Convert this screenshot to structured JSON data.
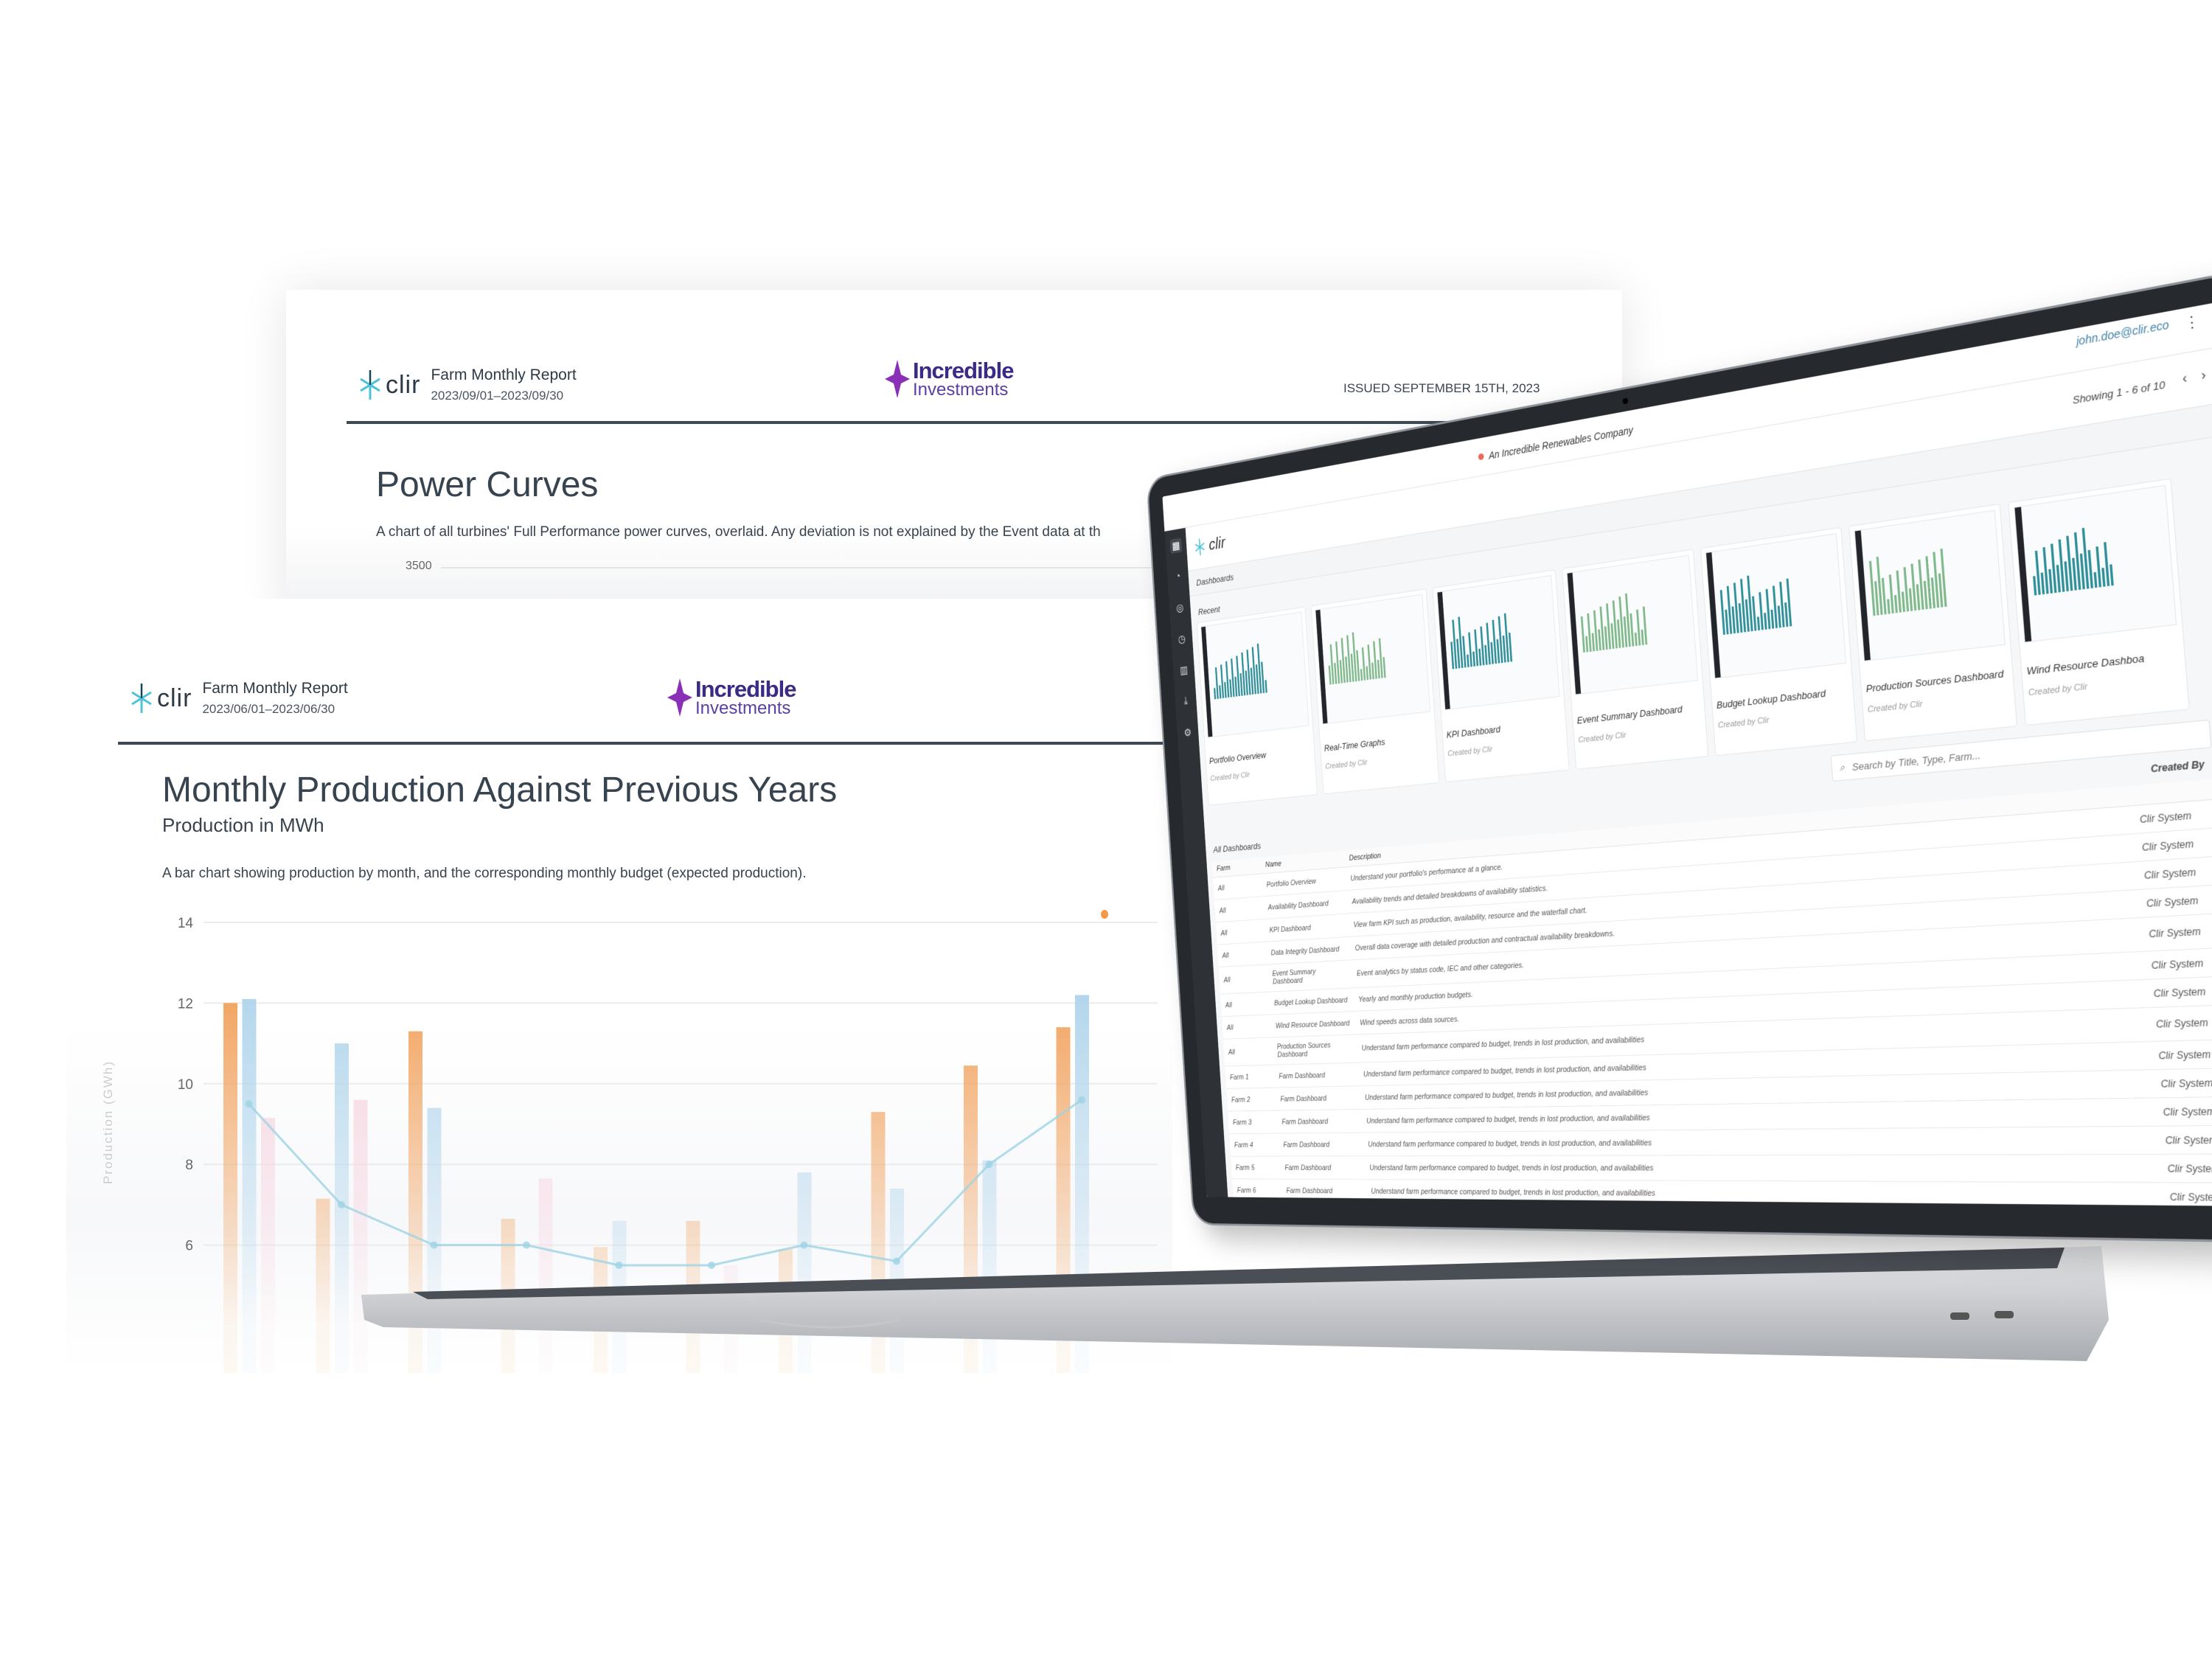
{
  "back_report": {
    "brand": "clir",
    "title": "Farm Monthly Report",
    "period": "2023/09/01–2023/09/30",
    "partner_line1": "Incredible",
    "partner_line2": "Investments",
    "issued": "ISSUED SEPTEMBER 15TH, 2023",
    "section_title": "Power Curves",
    "description": "A chart of all turbines' Full Performance power curves, overlaid. Any deviation is not explained by the Event data at th",
    "y_tick": "3500"
  },
  "front_report": {
    "brand": "clir",
    "title": "Farm Monthly Report",
    "period": "2023/06/01–2023/06/30",
    "partner_line1": "Incredible",
    "partner_line2": "Investments",
    "section_title": "Monthly Production Against Previous Years",
    "subtitle": "Production in MWh",
    "description": "A bar chart showing production by month, and the corresponding monthly budget (expected production)."
  },
  "chart_data": {
    "type": "bar",
    "ylabel": "Production (GWh)",
    "ylim": [
      0,
      14
    ],
    "yticks": [
      "6",
      "8",
      "10",
      "12",
      "14"
    ],
    "grid": true,
    "series": [
      {
        "color": "#f2a461",
        "values": [
          12.0,
          7.15,
          11.3,
          6.65,
          5.95,
          6.6,
          5.9,
          9.3,
          10.45,
          11.4
        ]
      },
      {
        "color": "#b3d6ec",
        "values": [
          12.1,
          11.0,
          9.4,
          null,
          6.6,
          null,
          7.8,
          7.4,
          8.1,
          12.2
        ]
      },
      {
        "color": "#f7d3df",
        "values": [
          9.15,
          9.6,
          null,
          7.65,
          null,
          5.5,
          null,
          null,
          null,
          null
        ]
      }
    ],
    "line": {
      "type": "line",
      "color": "#9fd3e4",
      "values": [
        9.5,
        7.0,
        6.0,
        6.0,
        5.5,
        5.5,
        6.0,
        5.6,
        8.0,
        9.6
      ]
    }
  },
  "app": {
    "company": "An Incredible Renewables Company",
    "user_email": "john.doe@clir.eco",
    "brand": "clir",
    "showing": "Showing 1 - 6 of 10",
    "breadcrumb": "Dashboards",
    "recent_label": "Recent",
    "recent_cards": [
      {
        "title": "Portfolio Overview",
        "creator": "Created by Clir"
      },
      {
        "title": "Real-Time Graphs",
        "creator": "Created by Clir"
      },
      {
        "title": "KPI Dashboard",
        "creator": "Created by Clir"
      },
      {
        "title": "Event Summary Dashboard",
        "creator": "Created by Clir"
      },
      {
        "title": "Budget Lookup Dashboard",
        "creator": "Created by Clir"
      },
      {
        "title": "Production Sources Dashboard",
        "creator": "Created by Clir"
      },
      {
        "title": "Wind Resource Dashboa",
        "creator": "Created by Clir"
      }
    ],
    "search_placeholder": "Search by Title, Type, Farm...",
    "all_label": "All Dashboards",
    "columns": {
      "farm": "Farm",
      "name": "Name",
      "description": "Description",
      "created_by": "Created By"
    },
    "rows": [
      {
        "farm": "All",
        "name": "Portfolio Overview",
        "description": "Understand your portfolio's performance at a glance.",
        "created_by": "Clir System"
      },
      {
        "farm": "All",
        "name": "Availability Dashboard",
        "description": "Availability trends and detailed breakdowns of availability statistics.",
        "created_by": "Clir System"
      },
      {
        "farm": "All",
        "name": "KPI Dashboard",
        "description": "View farm KPI such as production, availability, resource and the waterfall chart.",
        "created_by": "Clir System"
      },
      {
        "farm": "All",
        "name": "Data Integrity Dashboard",
        "description": "Overall data coverage with detailed production and contractual availability breakdowns.",
        "created_by": "Clir System"
      },
      {
        "farm": "All",
        "name": "Event Summary Dashboard",
        "description": "Event analytics by status code, IEC and other categories.",
        "created_by": "Clir System"
      },
      {
        "farm": "All",
        "name": "Budget Lookup Dashboard",
        "description": "Yearly and monthly production budgets.",
        "created_by": "Clir System"
      },
      {
        "farm": "All",
        "name": "Wind Resource Dashboard",
        "description": "Wind speeds across data sources.",
        "created_by": "Clir System"
      },
      {
        "farm": "All",
        "name": "Production Sources Dashboard",
        "description": "Understand farm performance compared to budget, trends in lost production, and availabilities",
        "created_by": "Clir System"
      },
      {
        "farm": "Farm 1",
        "name": "Farm Dashboard",
        "description": "Understand farm performance compared to budget, trends in lost production, and availabilities",
        "created_by": "Clir System"
      },
      {
        "farm": "Farm 2",
        "name": "Farm Dashboard",
        "description": "Understand farm performance compared to budget, trends in lost production, and availabilities",
        "created_by": "Clir System"
      },
      {
        "farm": "Farm 3",
        "name": "Farm Dashboard",
        "description": "Understand farm performance compared to budget, trends in lost production, and availabilities",
        "created_by": "Clir System"
      },
      {
        "farm": "Farm 4",
        "name": "Farm Dashboard",
        "description": "Understand farm performance compared to budget, trends in lost production, and availabilities",
        "created_by": "Clir System"
      },
      {
        "farm": "Farm 5",
        "name": "Farm Dashboard",
        "description": "Understand farm performance compared to budget, trends in lost production, and availabilities",
        "created_by": "Clir System"
      },
      {
        "farm": "Farm 6",
        "name": "Farm Dashboard",
        "description": "Understand farm performance compared to budget, trends in lost production, and availabilities",
        "created_by": "Clir System"
      }
    ],
    "sidebar_icons": [
      "dashboard-grid-icon",
      "pie-chart-icon",
      "target-icon",
      "stopwatch-icon",
      "report-icon",
      "download-icon",
      "settings-icon"
    ]
  },
  "colors": {
    "accent": "#4cc3d9",
    "partner_purple": "#8a2fb8",
    "rule": "#3d4a56",
    "status_dot": "#e8685a",
    "legend_dot": "#f29a45"
  }
}
